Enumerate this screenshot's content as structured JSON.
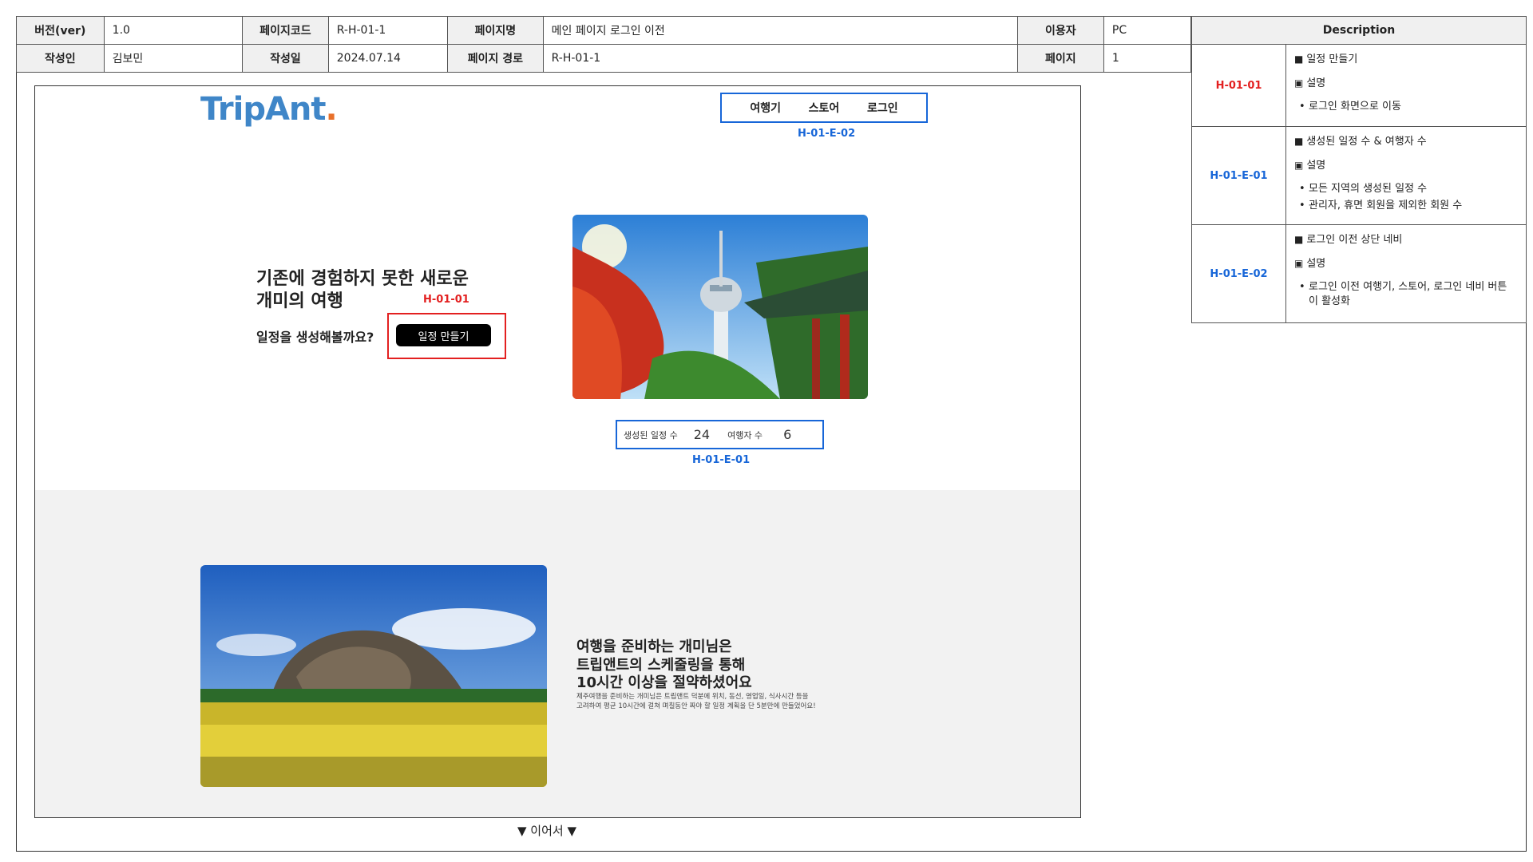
{
  "info": {
    "ver_label": "버전(ver)",
    "ver": "1.0",
    "page_code_label": "페이지코드",
    "page_code": "R-H-01-1",
    "page_name_label": "페이지명",
    "page_name": "메인 페이지 로그인 이전",
    "user_label": "이용자",
    "user": "PC",
    "author_label": "작성인",
    "author": "김보민",
    "date_label": "작성일",
    "date": "2024.07.14",
    "path_label": "페이지 경로",
    "path": "R-H-01-1",
    "page_label": "페이지",
    "page": "1"
  },
  "description": {
    "header": "Description",
    "items": [
      {
        "code": "H-01-01",
        "title": "일정 만들기",
        "sub": "설명",
        "bullets": [
          "로그인 화면으로 이동"
        ]
      },
      {
        "code": "H-01-E-01",
        "title": "생성된 일정 수 & 여행자 수",
        "sub": "설명",
        "bullets": [
          "모든 지역의 생성된 일정 수",
          "관리자, 휴면 회원을 제외한 회원 수"
        ]
      },
      {
        "code": "H-01-E-02",
        "title": "로그인 이전 상단 네비",
        "sub": "설명",
        "bullets": [
          "로그인 이전 여행기, 스토어, 로그인 네비 버튼 이 활성화"
        ]
      }
    ]
  },
  "screen": {
    "logo": "TripAnt",
    "logo_dot": ".",
    "nav": [
      "여행기",
      "스토어",
      "로그인"
    ],
    "nav_tag": "H-01-E-02",
    "hero_line1": "기존에 경험하지 못한 새로운",
    "hero_line2": "개미의 여행",
    "hero_sub": "일정을 생성해볼까요?",
    "cta": "일정 만들기",
    "cta_tag": "H-01-01",
    "stats_label1": "생성된 일정 수",
    "stats_value1": "24",
    "stats_label2": "여행자 수",
    "stats_value2": "6",
    "stats_tag": "H-01-E-01",
    "sec_line1": "여행을 준비하는 개미님은",
    "sec_line2": "트립앤트의 스케줄링을 통해",
    "sec_line3": "10시간 이상을 절약하셨어요",
    "sec_body1": "제주여행을 준비하는 개미님은 트립앤트 덕분에 위치, 동선, 영업일, 식사시간 등을",
    "sec_body2": "고려하여 평균 10시간에 걸쳐 며칠동안 짜야 할 일정 계획을 단 5분만에 만들었어요!"
  },
  "continue": "▼ 이어서 ▼",
  "colors": {
    "red_tag": "#e32020",
    "blue_tag": "#1766d8",
    "logo_blue": "#3f86c8",
    "logo_orange": "#e8702a"
  }
}
